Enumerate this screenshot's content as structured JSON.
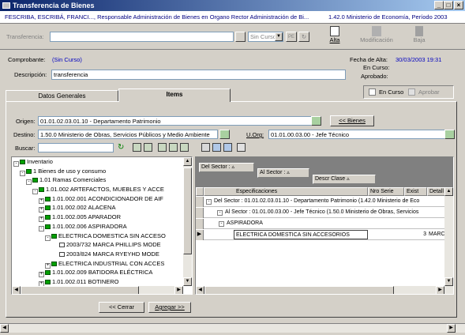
{
  "window": {
    "title": "Transferencia de Bienes",
    "min": "_",
    "max": "□",
    "close": "×"
  },
  "context": {
    "left": "FESCRIBA, ESCRIBÁ, FRANCI..., Responsable Administración de Bienes en Organo Rector Administración de Bi...",
    "right": "1.42.0 Ministerio de Economía, Período 2003"
  },
  "toolbar": {
    "transfer_label": "Transferencia:",
    "transfer_value": "",
    "sin_curso": "Sin Curso",
    "alta": "Alta",
    "modificacion": "Modificación",
    "baja": "Baja"
  },
  "header": {
    "comprobante_label": "Comprobante:",
    "comprobante_value": "(Sin Curso)",
    "descripcion_label": "Descripción:",
    "descripcion_value": "transferencia",
    "fecha_alta_label": "Fecha de Alta:",
    "fecha_alta_value": "30/03/2003 19:31",
    "en_curso_label": "En Curso:",
    "aprobado_label": "Aprobado:"
  },
  "tabs": [
    {
      "label": "Datos Generales"
    },
    {
      "label": "Items"
    }
  ],
  "checks": {
    "en_curso": "En Curso",
    "aprobar": "Aprobar"
  },
  "items": {
    "origen_label": "Origen:",
    "origen_value": "01.01.02.03.01.10 - Departamento Patrimonio",
    "bienes_button": "<< Bienes",
    "destino_label": "Destino:",
    "destino_value": "1.50.0 Ministerio de Obras, Servicios Públicos y Medio Ambiente",
    "uorg_label": "U.Org:",
    "uorg_value": "01.01.00.03.00 - Jefe Técnico",
    "buscar_label": "Buscar:",
    "buscar_value": ""
  },
  "tree": [
    {
      "text": "Inventario",
      "lvl": 0,
      "pm": "-"
    },
    {
      "text": "1 Bienes de uso y consumo",
      "lvl": 1,
      "pm": "-"
    },
    {
      "text": "1.01 Ramas Comerciales",
      "lvl": 2,
      "pm": "-"
    },
    {
      "text": "1.01.002 ARTEFACTOS,  MUEBLES Y ACCE",
      "lvl": 3,
      "pm": "-"
    },
    {
      "text": "1.01.002.001 ACONDICIONADOR DE AIF",
      "lvl": 4,
      "pm": "+"
    },
    {
      "text": "1.01.002.002 ALACENA",
      "lvl": 4,
      "pm": "+"
    },
    {
      "text": "1.01.002.005 APARADOR",
      "lvl": 4,
      "pm": "+"
    },
    {
      "text": "1.01.002.006 ASPIRADORA",
      "lvl": 4,
      "pm": "-"
    },
    {
      "text": "ELECTRICA DOMESTICA SIN ACCESO",
      "lvl": 5,
      "pm": "-"
    },
    {
      "text": "2003/732 MARCA  PHILLIPS MODE",
      "lvl": 6,
      "pm": ""
    },
    {
      "text": "2003/824 MARCA  RYEYHD MODE",
      "lvl": 6,
      "pm": ""
    },
    {
      "text": "ELECTRICA INDUSTRIAL CON ACCES",
      "lvl": 5,
      "pm": "+"
    },
    {
      "text": "1.01.002.009 BATIDORA ELÉCTRICA",
      "lvl": 4,
      "pm": "+"
    },
    {
      "text": "1.01.002.011 BOTINERO",
      "lvl": 4,
      "pm": "+"
    }
  ],
  "grid": {
    "group1": "Del Sector :",
    "group2": "Al Sector :",
    "group3": "Descr Clase",
    "col_spec": "Especificaciones",
    "col_serie": "Nro Serie",
    "col_exist": "Exist",
    "col_detalle": "Detall",
    "row1": "Del Sector : 01.01.02.03.01.10 - Departamento Patrimonio (1.42.0 Ministerio de Eco",
    "row2": "Al Sector : 01.01.00.03.00 - Jefe Técnico (1.50.0 Ministerio de Obras, Servicios",
    "row3": "ASPIRADORA",
    "row4_spec": "ELECTRICA DOMESTICA SIN ACCESORIOS",
    "row4_exist": "3",
    "row4_det": "MARC"
  },
  "buttons": {
    "cerrar": "<< Cerrar",
    "agregar": "Agregar >>"
  }
}
